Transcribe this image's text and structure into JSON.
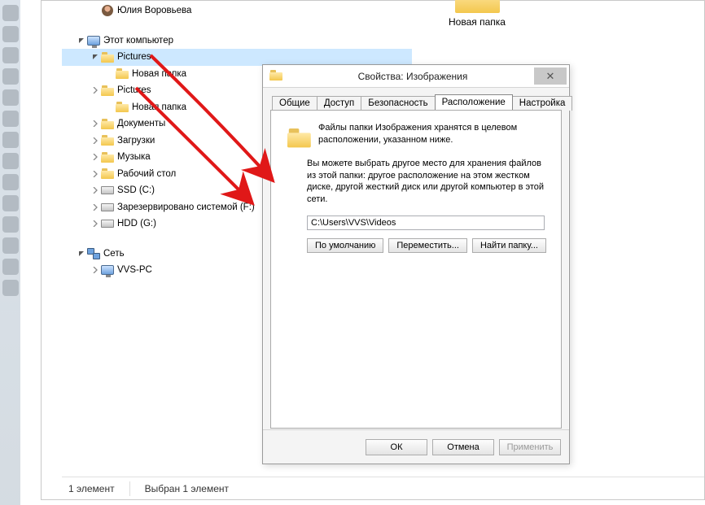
{
  "explorer": {
    "folder_thumb_label": "Новая папка",
    "status": {
      "count_label": "1 элемент",
      "selection_label": "Выбран 1 элемент"
    }
  },
  "tree": {
    "partial_top": "Юлия Воровьева",
    "this_pc": "Этот компьютер",
    "pictures1": "Pictures",
    "pictures1_sub": "Новая папка",
    "pictures2": "Pictures",
    "pictures2_sub": "Новая папка",
    "documents": "Документы",
    "downloads": "Загрузки",
    "music": "Музыка",
    "desktop": "Рабочий стол",
    "ssd": "SSD (C:)",
    "reserved": "Зарезервировано системой (F:)",
    "hdd": "HDD (G:)",
    "network": "Сеть",
    "vvs_pc": "VVS-PC"
  },
  "properties": {
    "title": "Свойства: Изображения",
    "tabs": {
      "general": "Общие",
      "access": "Доступ",
      "security": "Безопасность",
      "location": "Расположение",
      "customize": "Настройка"
    },
    "blurb": "Файлы папки Изображения хранятся в целевом расположении, указанном ниже.",
    "info": "Вы можете выбрать другое место для хранения файлов из этой папки: другое расположение на этом жестком диске, другой жесткий диск или другой компьютер в этой сети.",
    "path_value": "C:\\Users\\VVS\\Videos",
    "buttons": {
      "default": "По умолчанию",
      "move": "Переместить...",
      "find": "Найти папку..."
    },
    "footer": {
      "ok": "ОК",
      "cancel": "Отмена",
      "apply": "Применить"
    }
  }
}
